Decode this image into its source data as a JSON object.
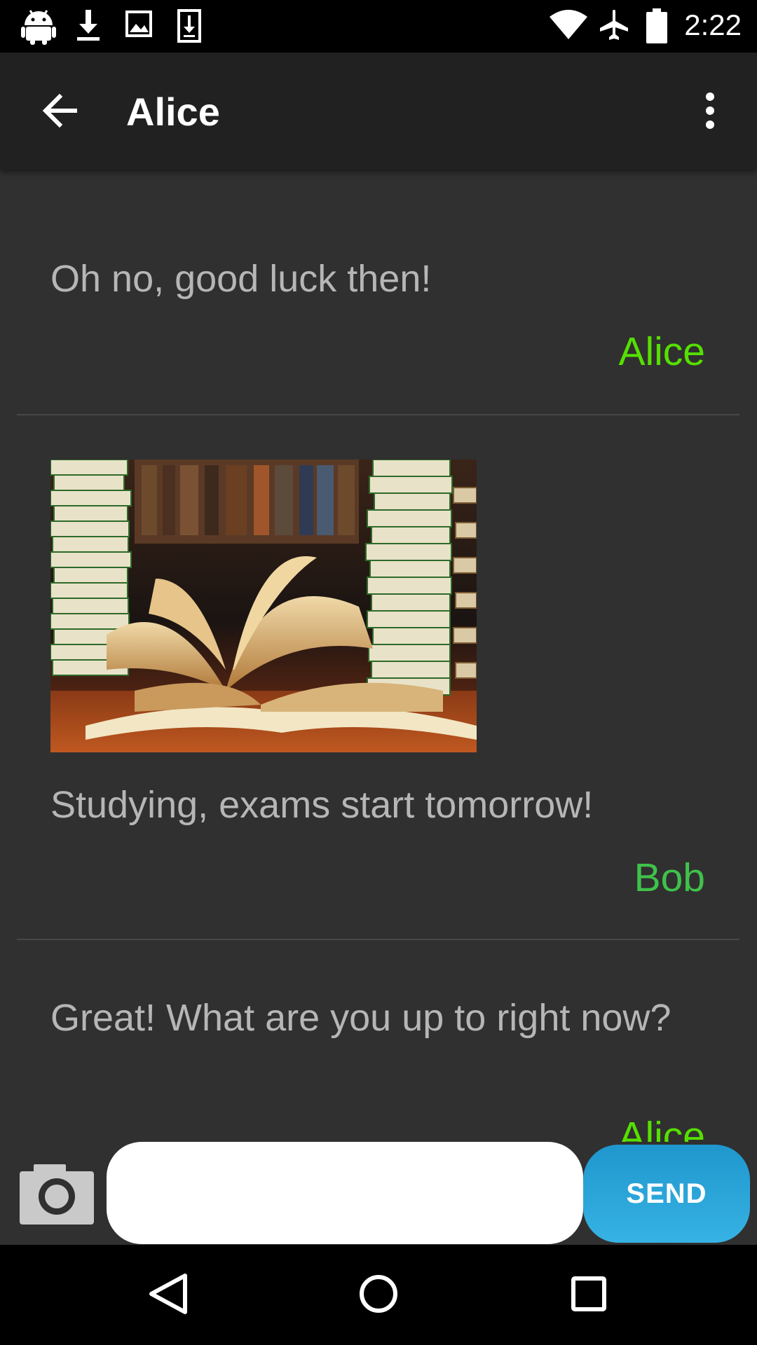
{
  "status_bar": {
    "time": "2:22",
    "left_icons": [
      "android-icon",
      "download-icon",
      "image-icon",
      "download-file-icon"
    ],
    "right_icons": [
      "wifi-icon",
      "airplane-mode-icon",
      "battery-icon"
    ]
  },
  "app_bar": {
    "title": "Alice",
    "back_icon": "arrow-left-icon",
    "overflow_icon": "more-vert-icon"
  },
  "messages": [
    {
      "text": "Oh no, good luck then!",
      "sender": "Alice",
      "sender_color": "#55e000"
    },
    {
      "image": "books-photo",
      "text": "Studying, exams start tomorrow!",
      "sender": "Bob",
      "sender_color": "#3fc24a"
    },
    {
      "text": "Great! What are you up to right now?",
      "sender": "Alice",
      "sender_color": "#55e000"
    }
  ],
  "composer": {
    "camera_icon": "camera-icon",
    "input_value": "",
    "send_label": "SEND"
  },
  "nav_bar": {
    "icons": [
      "back-triangle-icon",
      "home-circle-icon",
      "recents-square-icon"
    ]
  },
  "colors": {
    "background": "#303030",
    "app_bar": "#212121",
    "message_text": "#b6b6b6",
    "send_button": "#2aa6dc"
  }
}
